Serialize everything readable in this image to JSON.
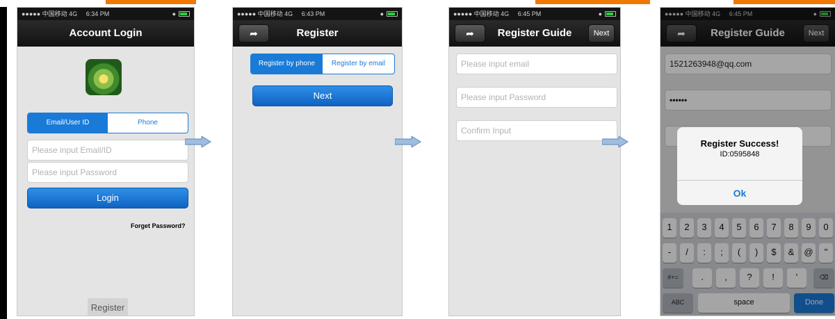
{
  "colors": {
    "accent": "#1a7ad8",
    "header_stripe": "#f07800",
    "navbar": "#1a1a1a"
  },
  "screens": [
    {
      "status": {
        "carrier": "●●●●● 中国移动 4G",
        "time": "6:34 PM"
      },
      "title": "Account Login",
      "logo_icon": "app-logo-icon",
      "tabs": [
        "Email/User ID",
        "Phone"
      ],
      "email_placeholder": "Please input Email/ID",
      "password_placeholder": "Please input Password",
      "login_label": "Login",
      "forgot_label": "Forget Password?",
      "register_label": "Register"
    },
    {
      "status": {
        "carrier": "●●●●● 中国移动 4G",
        "time": "6:43 PM"
      },
      "title": "Register",
      "back_icon": "back-arrow-icon",
      "tabs": [
        "Register by phone",
        "Register by email"
      ],
      "next_label": "Next"
    },
    {
      "status": {
        "carrier": "●●●●● 中国移动 4G",
        "time": "6:45 PM"
      },
      "title": "Register Guide",
      "back_icon": "back-arrow-icon",
      "next_label": "Next",
      "email_placeholder": "Please input email",
      "password_placeholder": "Please input Password",
      "confirm_placeholder": "Confirm Input"
    },
    {
      "status": {
        "carrier": "●●●●● 中国移动 4G",
        "time": "6:45 PM"
      },
      "title": "Register Guide",
      "back_icon": "back-arrow-icon",
      "next_label": "Next",
      "email_value": "1521263948@qq.com",
      "password_value": "••••••",
      "alert": {
        "title": "Register Success!",
        "message": "ID:0595848",
        "ok_label": "Ok"
      },
      "keyboard": {
        "row1": [
          "1",
          "2",
          "3",
          "4",
          "5",
          "6",
          "7",
          "8",
          "9",
          "0"
        ],
        "row2": [
          "-",
          "/",
          ":",
          ";",
          "(",
          ")",
          "$",
          "&",
          "@",
          "\""
        ],
        "row3": [
          ".",
          ",",
          "?",
          "!",
          "'"
        ],
        "symbols_key": "#+=",
        "abc_key": "ABC",
        "space_key": "space",
        "done_key": "Done"
      }
    }
  ]
}
